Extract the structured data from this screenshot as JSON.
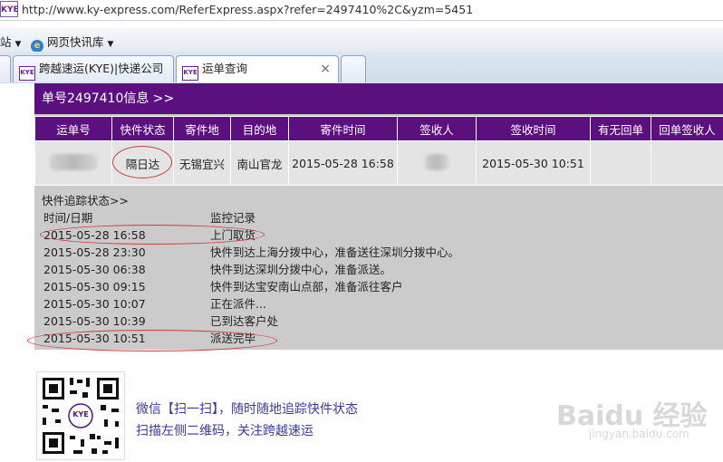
{
  "browser": {
    "url": "http://www.ky-express.com/ReferExpress.aspx?refer=2497410%2C&yzm=5451",
    "favorites_left": "站",
    "favorites_item": "网页快讯库",
    "tabs": [
      {
        "label": "跨越速运(KYE)|快递公司"
      },
      {
        "label": "运单查询",
        "active": true
      }
    ],
    "tab_close": "×",
    "logo_text": "KYE"
  },
  "waybill": {
    "header": "单号2497410信息  >>",
    "columns": [
      "运单号",
      "快件状态",
      "寄件地",
      "目的地",
      "寄件时间",
      "签收人",
      "签收时间",
      "有无回单",
      "回单签收人"
    ],
    "row": {
      "waybill_no": "",
      "status": "隔日达",
      "origin": "无锡宜兴",
      "destination": "南山官龙",
      "send_time": "2015-05-28    16:58",
      "signer": "",
      "sign_time": "2015-05-30    10:51",
      "receipt": "",
      "receipt_signer": ""
    }
  },
  "tracking": {
    "title": "快件追踪状态>>",
    "col_time": "时间/日期",
    "col_record": "监控记录",
    "events": [
      {
        "time": "2015-05-28    16:58",
        "desc": "上门取货"
      },
      {
        "time": "2015-05-28    23:30",
        "desc": "快件到达上海分拨中心，准备送往深圳分拨中心。"
      },
      {
        "time": "2015-05-30    06:38",
        "desc": "快件到达深圳分拨中心，准备派送。"
      },
      {
        "time": "2015-05-30    09:15",
        "desc": "快件到达宝安南山点部，准备派往客户"
      },
      {
        "time": "2015-05-30    10:07",
        "desc": "正在派件..."
      },
      {
        "time": "2015-05-30    10:39",
        "desc": "已到达客户处"
      },
      {
        "time": "2015-05-30    10:51",
        "desc": "派送完毕"
      }
    ]
  },
  "footer": {
    "qr_logo": "KYE",
    "line1": "微信【扫一扫】，随时随地追踪快件状态",
    "line2": "扫描左侧二维码，关注跨越速运"
  },
  "watermark": {
    "main": "Baidu 经验",
    "sub": "jingyan.baidu.com"
  },
  "colors": {
    "brand_purple": "#5c1080",
    "annotation_red": "#d03a3a",
    "panel_gray": "#cbcbcb"
  }
}
